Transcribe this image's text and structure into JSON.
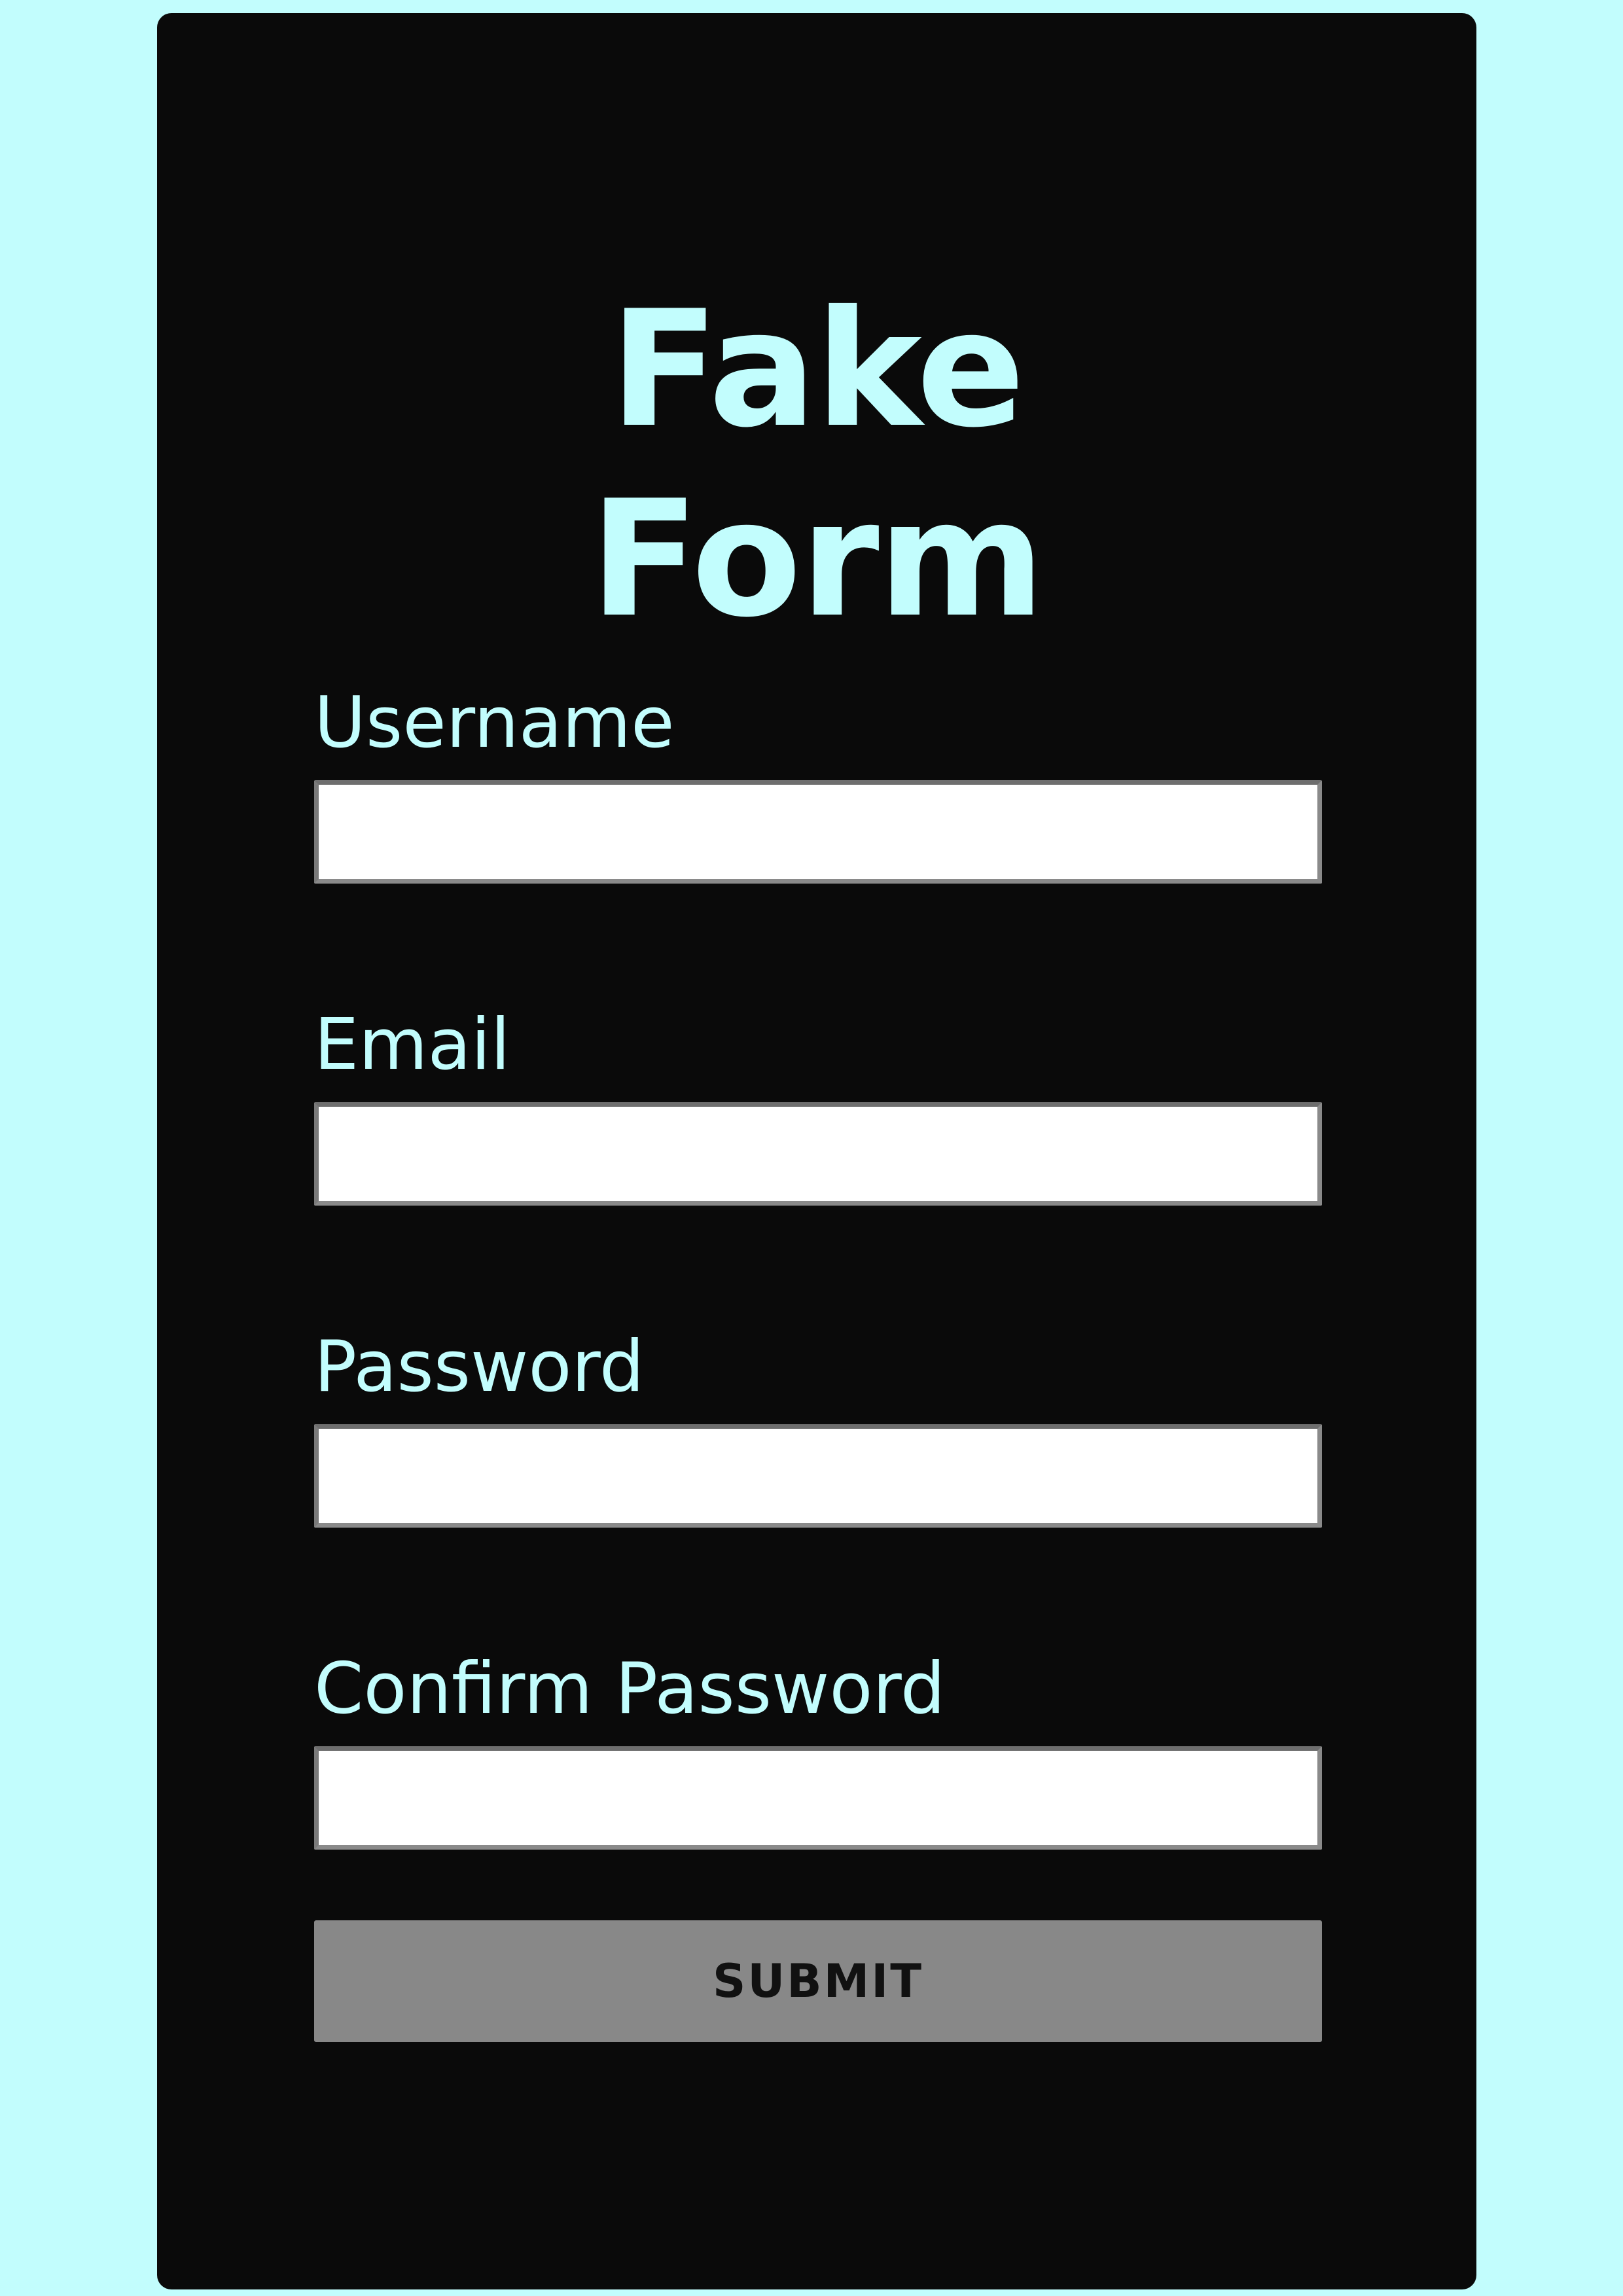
{
  "colors": {
    "background": "#c2fdfd",
    "card": "#0a0a0a",
    "accent_text": "#c2fdfd",
    "input_background": "#ffffff",
    "button_background": "#888888",
    "button_text": "#111111"
  },
  "form": {
    "title_line1": "Fake",
    "title_line2": "Form",
    "fields": [
      {
        "label": "Username",
        "value": "",
        "placeholder": ""
      },
      {
        "label": "Email",
        "value": "",
        "placeholder": ""
      },
      {
        "label": "Password",
        "value": "",
        "placeholder": ""
      },
      {
        "label": "Confirm Password",
        "value": "",
        "placeholder": ""
      }
    ],
    "submit_label": "SUBMIT"
  }
}
